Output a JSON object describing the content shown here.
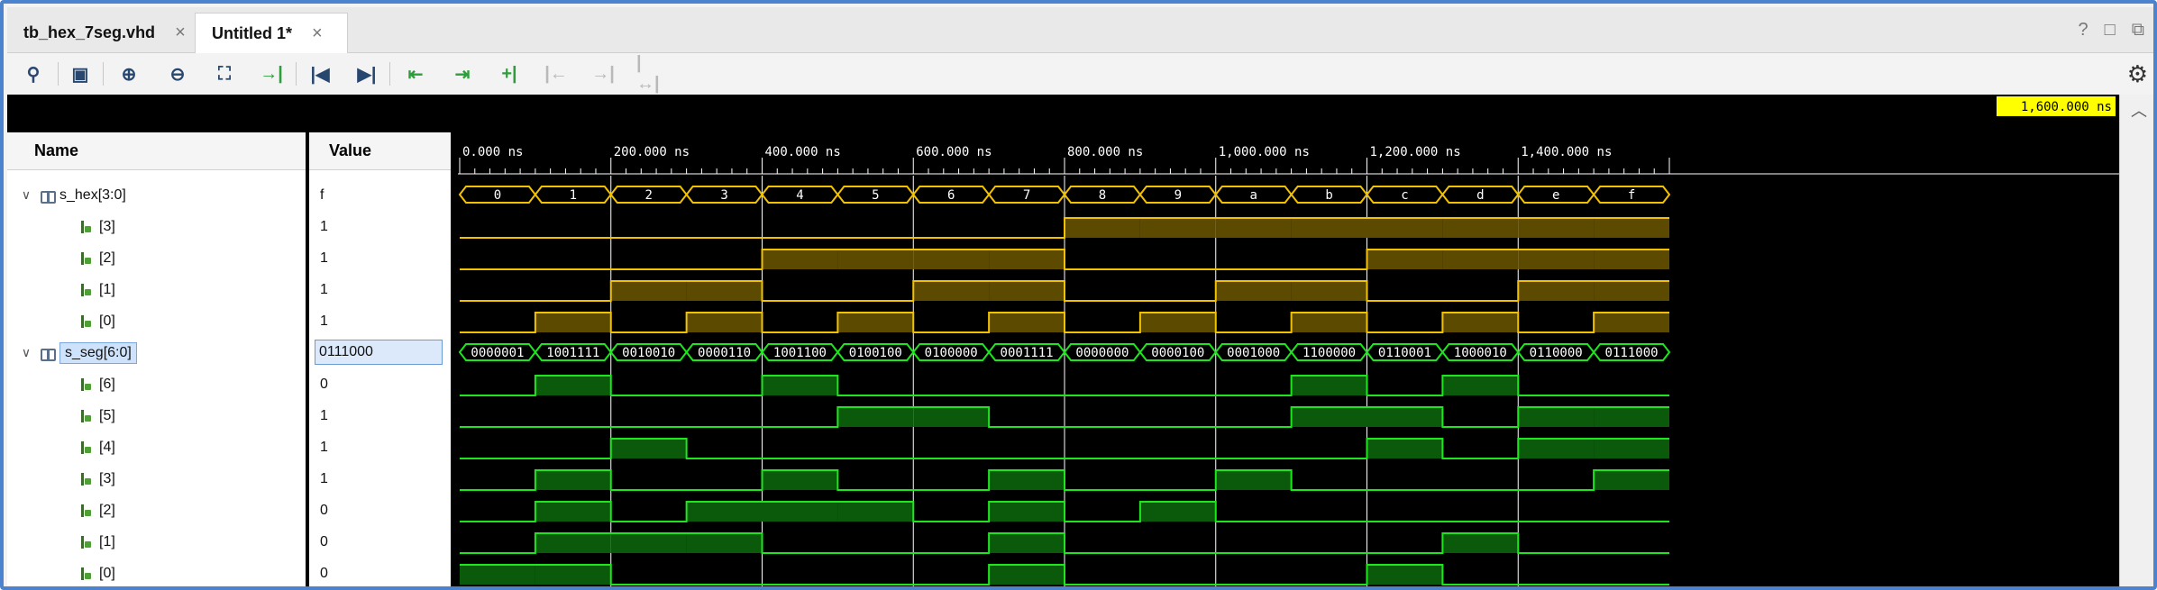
{
  "tabs": [
    {
      "label": "tb_hex_7seg.vhd",
      "close": "×"
    },
    {
      "label": "Untitled 1*",
      "close": "×"
    }
  ],
  "window_controls": [
    "?",
    "□",
    "⧉"
  ],
  "toolbar": {
    "icons": [
      "search-icon",
      "save-icon",
      "zoom-in-icon",
      "zoom-out-icon",
      "zoom-fit-icon",
      "go-to-cursor-icon",
      "go-to-time-zero-icon",
      "go-to-last-time-icon",
      "previous-transition-icon",
      "next-transition-icon",
      "add-marker-icon",
      "previous-marker-icon",
      "next-marker-icon",
      "swap-cursors-icon",
      "settings-icon"
    ]
  },
  "headers": {
    "name": "Name",
    "value": "Value"
  },
  "signals": [
    {
      "name": "s_hex[3:0]",
      "value": "f",
      "kind": "bus",
      "expanded": true
    },
    {
      "name": "[3]",
      "value": "1",
      "kind": "bit"
    },
    {
      "name": "[2]",
      "value": "1",
      "kind": "bit"
    },
    {
      "name": "[1]",
      "value": "1",
      "kind": "bit"
    },
    {
      "name": "[0]",
      "value": "1",
      "kind": "bit"
    },
    {
      "name": "s_seg[6:0]",
      "value": "0111000",
      "kind": "bus",
      "expanded": true,
      "selected": true
    },
    {
      "name": "[6]",
      "value": "0",
      "kind": "bit"
    },
    {
      "name": "[5]",
      "value": "1",
      "kind": "bit"
    },
    {
      "name": "[4]",
      "value": "1",
      "kind": "bit"
    },
    {
      "name": "[3]",
      "value": "1",
      "kind": "bit"
    },
    {
      "name": "[2]",
      "value": "0",
      "kind": "bit"
    },
    {
      "name": "[1]",
      "value": "0",
      "kind": "bit"
    },
    {
      "name": "[0]",
      "value": "0",
      "kind": "bit"
    }
  ],
  "waveform": {
    "cursor_time": "1,600.000 ns",
    "time_labels": [
      "0.000 ns",
      "200.000 ns",
      "400.000 ns",
      "600.000 ns",
      "800.000 ns",
      "1,000.000 ns",
      "1,200.000 ns",
      "1,400.000 ns"
    ],
    "time_end_ns": 1600,
    "step_ns": 100,
    "hex_bus_values": [
      "0",
      "1",
      "2",
      "3",
      "4",
      "5",
      "6",
      "7",
      "8",
      "9",
      "a",
      "b",
      "c",
      "d",
      "e",
      "f"
    ],
    "seg_bus_values": [
      "0000001",
      "1001111",
      "0010010",
      "0000110",
      "1001100",
      "0100100",
      "0100000",
      "0001111",
      "0000000",
      "0000100",
      "0001000",
      "1100000",
      "0110001",
      "1000010",
      "0110000",
      "0111000"
    ],
    "colors": {
      "hex": "#f2c200",
      "hex_fill": "#5c4a00",
      "seg": "#1ee61e",
      "seg_fill": "#0b5a0b",
      "cursor_bg": "#ffff00"
    }
  }
}
